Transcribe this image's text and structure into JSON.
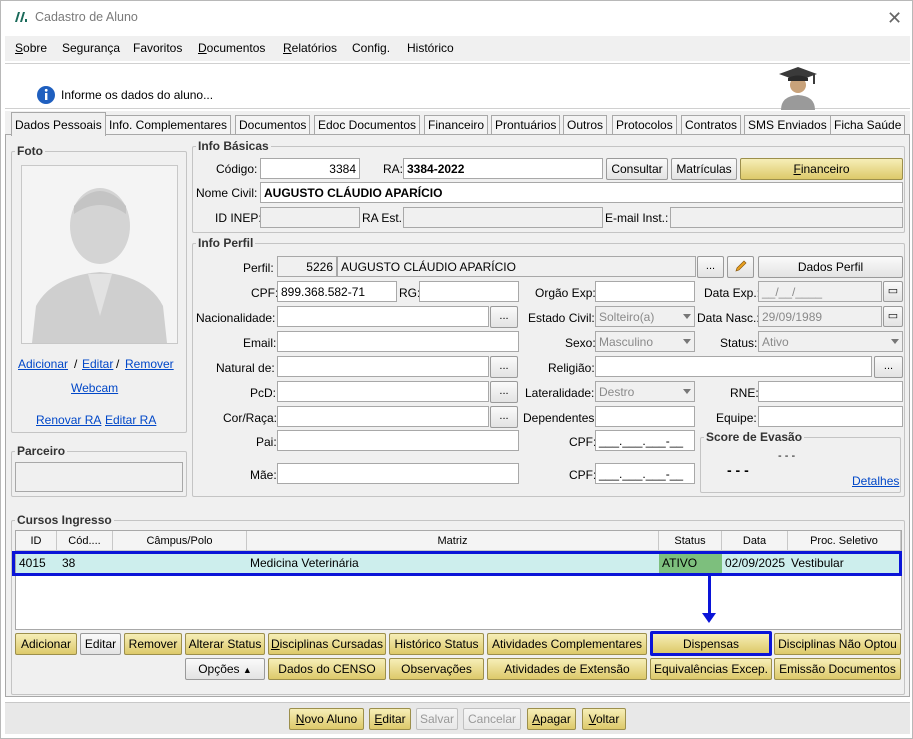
{
  "window": {
    "title": "Cadastro de Aluno"
  },
  "menu": [
    "Sobre",
    "Segurança",
    "Favoritos",
    "Documentos",
    "Relatórios",
    "Config.",
    "Histórico"
  ],
  "banner": {
    "message": "Informe os dados do aluno..."
  },
  "tabs": [
    "Dados Pessoais",
    "Info. Complementares",
    "Documentos",
    "Edoc Documentos",
    "Financeiro",
    "Prontuários",
    "Outros",
    "Protocolos",
    "Contratos",
    "SMS Enviados",
    "Ficha Saúde"
  ],
  "foto": {
    "title": "Foto",
    "adicionar": "Adicionar",
    "editar": "Editar",
    "remover": "Remover",
    "sep": "/",
    "webcam": "Webcam",
    "renovar_ra": "Renovar RA",
    "editar_ra": "Editar RA"
  },
  "parceiro": {
    "title": "Parceiro"
  },
  "info_basicas": {
    "title": "Info Básicas",
    "codigo_label": "Código:",
    "codigo": "3384",
    "ra_label": "RA:",
    "ra": "3384-2022",
    "consultar": "Consultar",
    "matriculas": "Matrículas",
    "financeiro": "Financeiro",
    "nome_civil_label": "Nome Civil:",
    "nome_civil": "AUGUSTO CLÁUDIO APARÍCIO",
    "id_inep_label": "ID INEP:",
    "ra_est_label": "RA Est.:",
    "email_inst_label": "E-mail Inst.:"
  },
  "info_perfil": {
    "title": "Info Perfil",
    "perfil_label": "Perfil:",
    "perfil_code": "5226",
    "perfil_name": "AUGUSTO CLÁUDIO APARÍCIO",
    "ellipsis": "...",
    "dados_perfil": "Dados Perfil",
    "cpf_label": "CPF:",
    "cpf": "899.368.582-71",
    "rg_label": "RG:",
    "orgao_exp_label": "Orgão Exp:",
    "data_exp_label": "Data Exp.:",
    "data_exp": "__/__/____",
    "nacionalidade_label": "Nacionalidade:",
    "estado_civil_label": "Estado Civil:",
    "estado_civil": "Solteiro(a)",
    "data_nasc_label": "Data Nasc.:",
    "data_nasc": "29/09/1989",
    "email_label": "Email:",
    "sexo_label": "Sexo:",
    "sexo": "Masculino",
    "status_label": "Status:",
    "status": "Ativo",
    "natural_label": "Natural de:",
    "religiao_label": "Religião:",
    "pcd_label": "PcD:",
    "lateralidade_label": "Lateralidade:",
    "lateralidade": "Destro",
    "rne_label": "RNE:",
    "cor_label": "Cor/Raça:",
    "dependentes_label": "Dependentes:",
    "equipe_label": "Equipe:",
    "pai_label": "Pai:",
    "mae_label": "Mãe:",
    "cpf2_label": "CPF:",
    "cpf_mask": "___.___.___-__",
    "score_title": "Score de Evasão",
    "score_value": "- - -",
    "score_small": "- - -",
    "detalhes": "Detalhes"
  },
  "cursos": {
    "title": "Cursos Ingresso",
    "columns": [
      "ID",
      "Cód....",
      "Câmpus/Polo",
      "Matriz",
      "Status",
      "Data",
      "Proc. Seletivo"
    ],
    "row": {
      "id": "4015",
      "cod": "38",
      "campus": "",
      "matriz": "Medicina Veterinária",
      "status": "ATIVO",
      "data": "02/09/2025",
      "proc": "Vestibular"
    }
  },
  "actions_row1": [
    "Adicionar",
    "Editar",
    "Remover",
    "Alterar Status",
    "Disciplinas Cursadas",
    "Histórico Status",
    "Atividades Complementares",
    "Dispensas",
    "Disciplinas Não Optou"
  ],
  "actions_row2": [
    "Opções",
    "Dados do CENSO",
    "Observações",
    "Atividades de Extensão",
    "Equivalências Excep.",
    "Emissão Documentos"
  ],
  "footer": [
    "Novo Aluno",
    "Editar",
    "Salvar",
    "Cancelar",
    "Apagar",
    "Voltar"
  ],
  "colors": {
    "highlight": "#0a14d8",
    "status_green": "#7dbf7d",
    "row_bg": "#cdeeed",
    "yellow_btn": "#e6d88a"
  }
}
